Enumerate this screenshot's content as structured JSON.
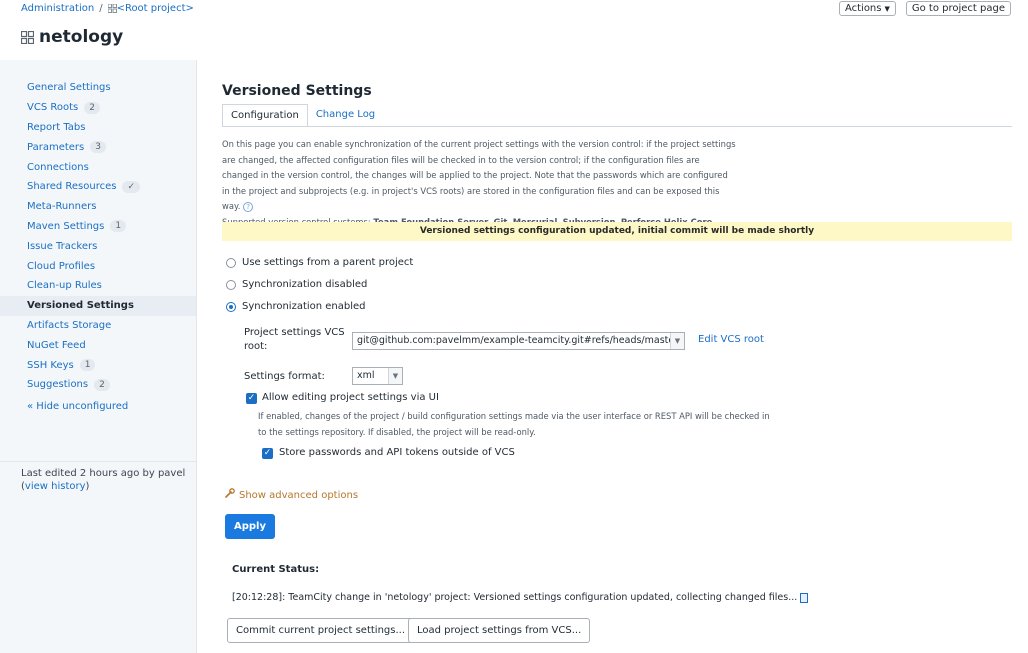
{
  "header": {
    "breadcrumb_admin": "Administration",
    "breadcrumb_sep": "/",
    "breadcrumb_root": "<Root project>",
    "project_name": "netology",
    "actions_label": "Actions",
    "goto_label": "Go to project page"
  },
  "sidebar": {
    "items": [
      {
        "label": "General Settings",
        "badge": ""
      },
      {
        "label": "VCS Roots",
        "badge": "2"
      },
      {
        "label": "Report Tabs",
        "badge": ""
      },
      {
        "label": "Parameters",
        "badge": "3"
      },
      {
        "label": "Connections",
        "badge": ""
      },
      {
        "label": "Shared Resources",
        "badge": "✓"
      },
      {
        "label": "Meta-Runners",
        "badge": ""
      },
      {
        "label": "Maven Settings",
        "badge": "1"
      },
      {
        "label": "Issue Trackers",
        "badge": ""
      },
      {
        "label": "Cloud Profiles",
        "badge": ""
      },
      {
        "label": "Clean-up Rules",
        "badge": ""
      },
      {
        "label": "Versioned Settings",
        "badge": "",
        "active": true
      },
      {
        "label": "Artifacts Storage",
        "badge": ""
      },
      {
        "label": "NuGet Feed",
        "badge": ""
      },
      {
        "label": "SSH Keys",
        "badge": "1"
      },
      {
        "label": "Suggestions",
        "badge": "2"
      }
    ],
    "hide_unconfigured": "« Hide unconfigured",
    "last_edited": "Last edited 2 hours ago by pavel",
    "view_history_open": "(",
    "view_history": "view history",
    "view_history_close": ")"
  },
  "main": {
    "title": "Versioned Settings",
    "tabs": [
      {
        "label": "Configuration",
        "active": true
      },
      {
        "label": "Change Log",
        "active": false
      }
    ],
    "description": "On this page you can enable synchronization of the current project settings with the version control: if the project settings are changed, the affected configuration files will be checked in to the version control; if the configuration files are changed in the version control, the changes will be applied to the project. Note that the passwords which are configured in the project and subprojects (e.g. in project's VCS roots) are stored in the configuration files and can be exposed this way.",
    "supported_prefix": "Supported version control systems: ",
    "vcs_1": "Team Foundation Server",
    "vcs_2": "Git",
    "vcs_3": "Mercurial",
    "vcs_4": "Subversion",
    "vcs_5": "Perforce Helix Core",
    "comma": ", ",
    "period": ".",
    "help_glyph": "?",
    "banner": "Versioned settings configuration updated, initial commit will be made shortly",
    "radio_parent": "Use settings from a parent project",
    "radio_disabled": "Synchronization disabled",
    "radio_enabled": "Synchronization enabled",
    "vcs_root_label": "Project settings VCS root:",
    "vcs_root_value": "git@github.com:pavelmm/example-teamcity.git#refs/heads/master",
    "edit_vcs_root": "Edit VCS root",
    "format_label": "Settings format:",
    "format_value": "xml",
    "allow_editing_label": "Allow editing project settings via UI",
    "allow_editing_desc": "If enabled, changes of the project / build configuration settings made via the user interface or REST API will be checked in to the settings repository. If disabled, the project will be read-only.",
    "store_passwords_label": "Store passwords and API tokens outside of VCS",
    "advanced_options": "Show advanced options",
    "apply": "Apply",
    "current_status_label": "Current Status:",
    "status_text": "[20:12:28]: TeamCity change in 'netology' project: Versioned settings configuration updated, collecting changed files...",
    "commit_button": "Commit current project settings...",
    "load_button": "Load project settings from VCS..."
  },
  "icons": {
    "project": "grid-icon",
    "advanced": "wrench-icon",
    "status": "document-icon",
    "help": "help-icon"
  },
  "colors": {
    "link": "#1a6fc4",
    "apply_button": "#1a7ae0",
    "banner_bg": "#fdf8c6",
    "sidebar_bg": "#f4f7fa",
    "advanced_link": "#b7772c"
  }
}
